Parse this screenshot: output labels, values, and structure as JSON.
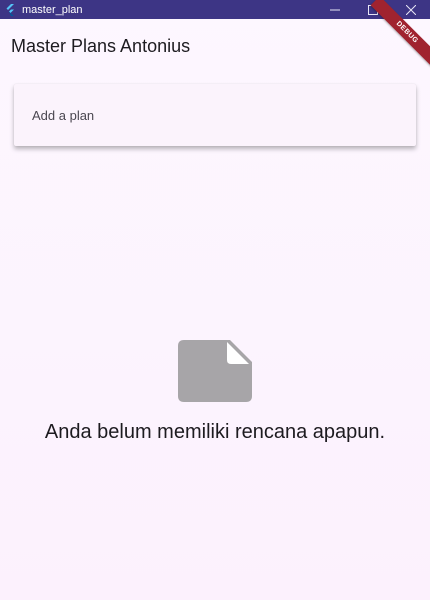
{
  "window": {
    "title": "master_plan",
    "icon": "flutter-icon",
    "controls": [
      "minimize-icon",
      "maximize-icon",
      "close-icon"
    ]
  },
  "appbar": {
    "title": "Master Plans Antonius"
  },
  "debug_banner": {
    "label": "DEBUG"
  },
  "plan_input": {
    "placeholder": "Add a plan",
    "value": ""
  },
  "empty_state": {
    "icon": "note-icon",
    "message": "Anda belum memiliki rencana apapun."
  },
  "colors": {
    "titlebar": "#3d3585",
    "background": "#fcf3fd",
    "debug_banner": "#a0232f",
    "icon_grey": "#9e9e9e"
  }
}
